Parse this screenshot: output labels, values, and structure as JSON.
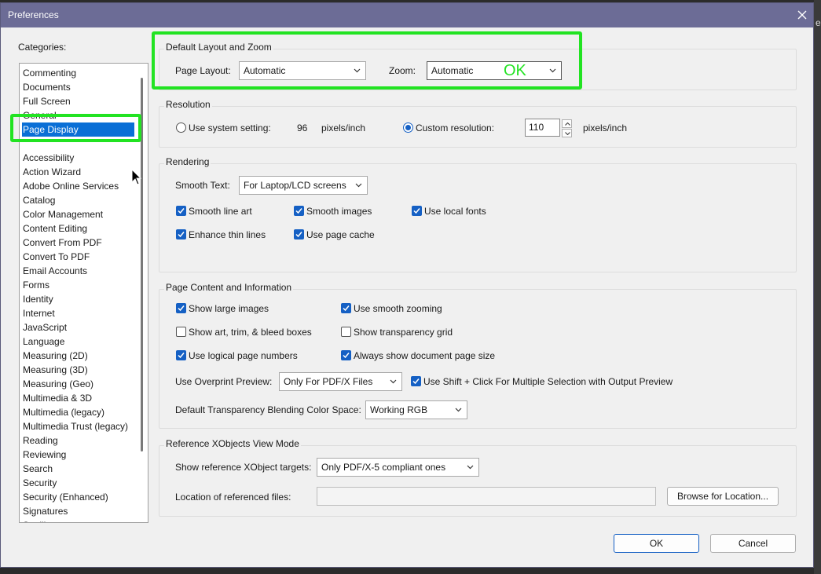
{
  "window": {
    "title": "Preferences"
  },
  "background": {
    "edge_text": "e"
  },
  "categories": {
    "label": "Categories:",
    "selected": "Page Display",
    "items": [
      "Commenting",
      "Documents",
      "Full Screen",
      "General",
      "Page Display",
      "Accessibility",
      "Action Wizard",
      "Adobe Online Services",
      "Catalog",
      "Color Management",
      "Content Editing",
      "Convert From PDF",
      "Convert To PDF",
      "Email Accounts",
      "Forms",
      "Identity",
      "Internet",
      "JavaScript",
      "Language",
      "Measuring (2D)",
      "Measuring (3D)",
      "Measuring (Geo)",
      "Multimedia & 3D",
      "Multimedia (legacy)",
      "Multimedia Trust (legacy)",
      "Reading",
      "Reviewing",
      "Search",
      "Security",
      "Security (Enhanced)",
      "Signatures",
      "Spelling"
    ]
  },
  "layout_zoom": {
    "title": "Default Layout and Zoom",
    "page_layout_label": "Page Layout:",
    "page_layout_value": "Automatic",
    "zoom_label": "Zoom:",
    "zoom_value": "Automatic",
    "overlay_text": "OK"
  },
  "resolution": {
    "title": "Resolution",
    "system_label": "Use system setting:",
    "system_value": "96",
    "system_unit": "pixels/inch",
    "custom_label": "Custom resolution:",
    "custom_value": "110",
    "custom_unit": "pixels/inch",
    "selected": "custom"
  },
  "rendering": {
    "title": "Rendering",
    "smooth_text_label": "Smooth Text:",
    "smooth_text_value": "For Laptop/LCD screens",
    "smooth_line_art": "Smooth line art",
    "smooth_images": "Smooth images",
    "use_local_fonts": "Use local fonts",
    "enhance_thin_lines": "Enhance thin lines",
    "use_page_cache": "Use page cache"
  },
  "page_content": {
    "title": "Page Content and Information",
    "show_large_images": "Show large images",
    "use_smooth_zooming": "Use smooth zooming",
    "show_art_trim": "Show art, trim, & bleed boxes",
    "show_transparency_grid": "Show transparency grid",
    "use_logical_page_numbers": "Use logical page numbers",
    "always_show_page_size": "Always show document page size",
    "overprint_label": "Use Overprint Preview:",
    "overprint_value": "Only For PDF/X Files",
    "shift_click": "Use Shift + Click For Multiple Selection with Output Preview",
    "blending_label": "Default Transparency Blending Color Space:",
    "blending_value": "Working RGB"
  },
  "xobjects": {
    "title": "Reference XObjects View Mode",
    "targets_label": "Show reference XObject targets:",
    "targets_value": "Only PDF/X-5 compliant ones",
    "location_label": "Location of referenced files:",
    "location_value": "",
    "browse_label": "Browse for Location..."
  },
  "footer": {
    "ok_label": "OK",
    "cancel_label": "Cancel"
  },
  "colors": {
    "title_bar": "#6c6c96",
    "accent": "#1560c4",
    "selection": "#0a6fd6",
    "highlight": "#22e322"
  },
  "icons": {
    "close": "close-icon",
    "check": "check-icon",
    "chevron": "chevron-down-icon",
    "cursor": "mouse-cursor-icon"
  }
}
